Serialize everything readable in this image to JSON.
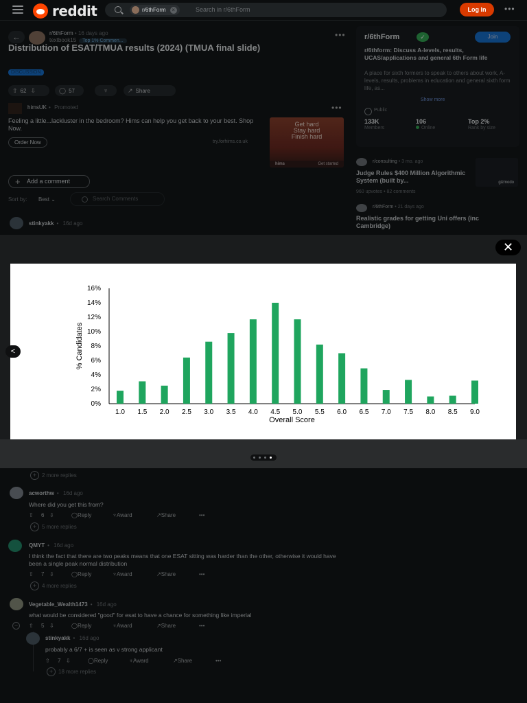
{
  "header": {
    "brand": "reddit",
    "search_chip": "r/6thForm",
    "search_chip_close": "×",
    "search_placeholder": "Search in r/6thForm",
    "login_label": "Log In",
    "more_label": "•••"
  },
  "post": {
    "back_glyph": "←",
    "subreddit": "r/6thForm",
    "time": "16 days ago",
    "author": "textbook15",
    "author_badge": "Top 1% Commen...",
    "more_label": "•••",
    "title": "Distribution of ESAT/TMUA results (2024) (TMUA final slide)",
    "flair": "DISCUSSION",
    "upvotes": "62",
    "comments": "57",
    "share_label": "Share"
  },
  "ad": {
    "advertiser": "himsUK",
    "promoted_label": "Promoted",
    "more_label": "•••",
    "text": "Feeling a little...lackluster in the bedroom? Hims can help you get back to your best. Shop Now.",
    "cta_label": "Order Now",
    "domain": "try.forhims.co.uk",
    "image_text": [
      "Get hard",
      "Stay hard",
      "Finish hard"
    ],
    "image_brand": "hims",
    "image_cta": "Get started"
  },
  "comments_bar": {
    "add_comment_label": "Add a comment",
    "sort_label": "Sort by:",
    "sort_value": "Best",
    "search_placeholder": "Search Comments"
  },
  "first_comment": {
    "user": "stinkyakk",
    "time": "16d ago"
  },
  "sidebar": {
    "title": "r/6thForm",
    "verified_glyph": "✓",
    "join_label": "Join",
    "description": "r/6thform: Discuss A-levels, results, UCAS/applications and general 6th Form life",
    "subtitle": "A place for sixth formers to speak to others about work, A-levels, results, problems in education and general sixth form life, as...",
    "show_more_label": "Show more",
    "visibility": "Public",
    "stats": [
      {
        "value": "133K",
        "label": "Members"
      },
      {
        "value": "106",
        "label": "Online"
      },
      {
        "value": "Top 2%",
        "label": "Rank by size"
      }
    ],
    "related": [
      {
        "subreddit": "r/consulting",
        "time": "3 mo. ago",
        "title": "Judge Rules $400 Million Algorithmic System (built by...",
        "upvotes": "960 upvotes",
        "comments": "82 comments",
        "thumb_label": "gizmodo"
      },
      {
        "subreddit": "r/6thForm",
        "time": "21 days ago",
        "title": "Realistic grades for getting Uni offers (inc Cambridge)"
      }
    ]
  },
  "lightbox": {
    "close_glyph": "✕",
    "prev_glyph": "<",
    "page_count": 4,
    "current_page": 4
  },
  "chart_data": {
    "type": "bar",
    "categories": [
      "1.0",
      "1.5",
      "2.0",
      "2.5",
      "3.0",
      "3.5",
      "4.0",
      "4.5",
      "5.0",
      "5.5",
      "6.0",
      "6.5",
      "7.0",
      "7.5",
      "8.0",
      "8.5",
      "9.0"
    ],
    "values": [
      1.8,
      3.1,
      2.5,
      6.4,
      8.6,
      9.8,
      11.7,
      14.0,
      11.7,
      8.2,
      7.0,
      4.9,
      1.9,
      3.3,
      1.0,
      1.1,
      3.2
    ],
    "xlabel": "Overall Score",
    "ylabel": "% Candidates",
    "ylim": [
      0,
      16
    ],
    "yticks": [
      "0%",
      "2%",
      "4%",
      "6%",
      "8%",
      "10%",
      "12%",
      "14%",
      "16%"
    ],
    "grid": false,
    "bar_color": "#1fa55e"
  },
  "lower_comments": {
    "more_replies_top": "2 more replies",
    "comments": [
      {
        "user": "acworthw",
        "time": "16d ago",
        "body": "Where did you get this from?",
        "votes": "6",
        "more_replies": "5 more replies"
      },
      {
        "user": "QMYT",
        "time": "16d ago",
        "body": "I think the fact that there are two peaks means that one ESAT sitting was harder than the other, otherwise it would have been a single peak normal distribution",
        "votes": "7",
        "more_replies": "4 more replies"
      },
      {
        "user": "Vegetable_Wealth1473",
        "time": "16d ago",
        "body": "what would be considered \"good\" for esat to have a chance for something like imperial",
        "votes": "5"
      },
      {
        "user": "stinkyakk",
        "time": "16d ago",
        "body": "probably a 6/7 + is seen as v strong applicant",
        "votes": "7",
        "more_replies": "18 more replies"
      }
    ],
    "reply_label": "Reply",
    "award_label": "Award",
    "share_label": "Share",
    "more_label": "•••"
  }
}
